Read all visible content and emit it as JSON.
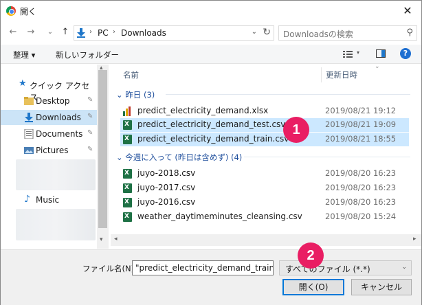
{
  "window": {
    "title": "開く",
    "close_glyph": "✕"
  },
  "nav": {
    "back": "←",
    "forward": "→",
    "recent": "⌄",
    "up": "↑",
    "breadcrumb": [
      "PC",
      "Downloads"
    ],
    "crumb_sep": "›",
    "search_placeholder": "Downloadsの検索"
  },
  "toolbar": {
    "organize": "整理 ▾",
    "new_folder": "新しいフォルダー",
    "help": "?"
  },
  "sidebar": {
    "quick_access": "クイック アクセス",
    "items": [
      {
        "label": "Desktop",
        "icon": "folder-icon",
        "pinned": true
      },
      {
        "label": "Downloads",
        "icon": "download-icon",
        "pinned": true,
        "selected": true
      },
      {
        "label": "Documents",
        "icon": "documents-icon",
        "pinned": true
      },
      {
        "label": "Pictures",
        "icon": "pictures-icon",
        "pinned": true
      }
    ],
    "music": "Music",
    "pin_glyph": "📌"
  },
  "columns": {
    "name": "名前",
    "modified": "更新日時"
  },
  "groups": [
    {
      "label": "昨日 (3)",
      "files": [
        {
          "name": "predict_electricity_demand.xlsx",
          "date": "2019/08/21 19:12",
          "icon": "excel-chart-icon",
          "selected": false
        },
        {
          "name": "predict_electricity_demand_test.csv",
          "date": "2019/08/21 19:09",
          "icon": "csv-icon",
          "selected": true
        },
        {
          "name": "predict_electricity_demand_train.csv",
          "date": "2019/08/21 18:55",
          "icon": "csv-icon",
          "selected": true
        }
      ]
    },
    {
      "label": "今週に入って (昨日は含めず) (4)",
      "files": [
        {
          "name": "juyo-2018.csv",
          "date": "2019/08/20 16:23",
          "icon": "csv-icon",
          "selected": false
        },
        {
          "name": "juyo-2017.csv",
          "date": "2019/08/20 16:23",
          "icon": "csv-icon",
          "selected": false
        },
        {
          "name": "juyo-2016.csv",
          "date": "2019/08/20 16:23",
          "icon": "csv-icon",
          "selected": false
        },
        {
          "name": "weather_daytimeminutes_cleansing.csv",
          "date": "2019/08/20 15:24",
          "icon": "csv-icon",
          "selected": false
        }
      ]
    }
  ],
  "footer": {
    "filename_label": "ファイル名(N):",
    "filename_value": "\"predict_electricity_demand_train.c:",
    "filetype_value": "すべてのファイル (*.*)",
    "open_button": "開く(O)",
    "cancel_button": "キャンセル"
  },
  "badges": [
    "1",
    "2"
  ],
  "colors": {
    "accent": "#0078d7",
    "badge": "#e91e63",
    "selection": "#cce8ff"
  }
}
